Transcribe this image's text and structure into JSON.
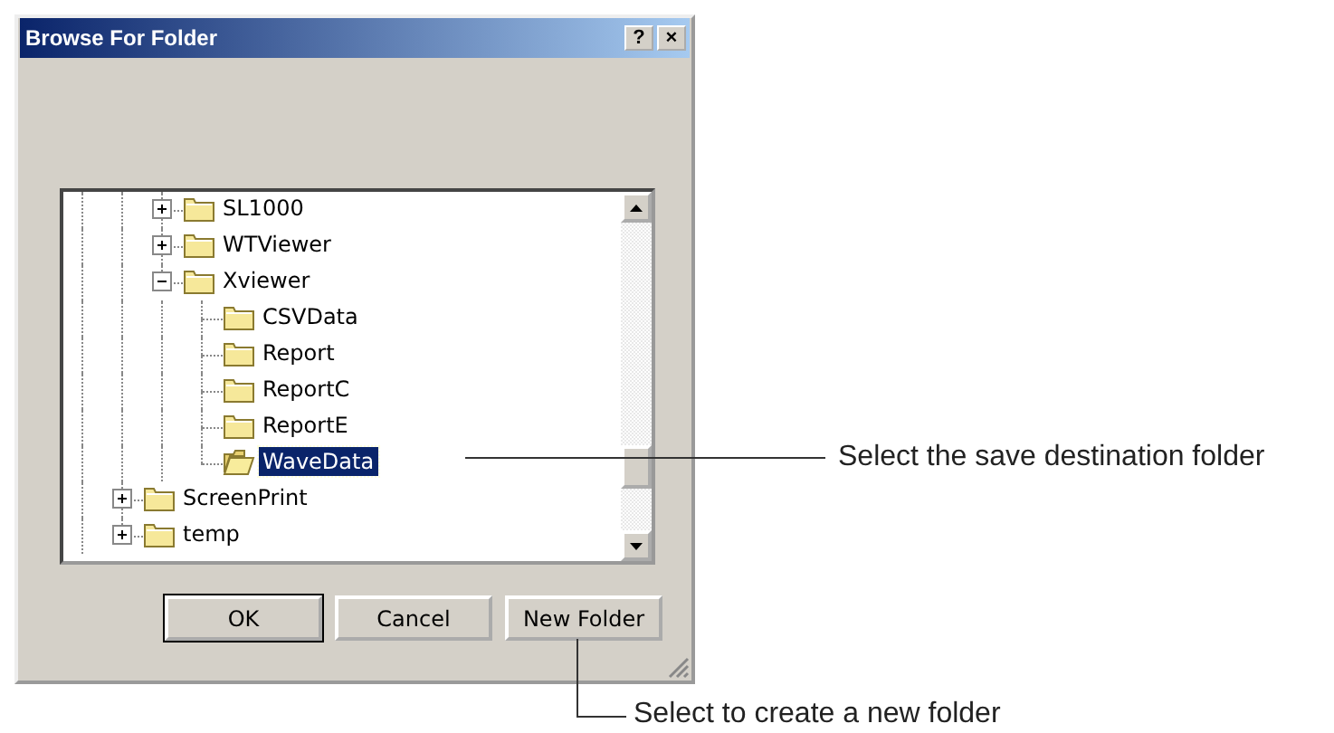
{
  "window": {
    "title": "Browse For Folder",
    "title_buttons": [
      "?",
      "×"
    ]
  },
  "tree": {
    "items": [
      {
        "children": [
          {
            "label": "SL1000",
            "expanded": false,
            "selected": false
          },
          {
            "label": "WTViewer",
            "expanded": false,
            "selected": false
          },
          {
            "label": "Xviewer",
            "expanded": true,
            "selected": false,
            "children": [
              {
                "label": "CSVData",
                "selected": false
              },
              {
                "label": "Report",
                "selected": false
              },
              {
                "label": "ReportC",
                "selected": false
              },
              {
                "label": "ReportE",
                "selected": false
              },
              {
                "label": "WaveData",
                "selected": true
              }
            ]
          }
        ]
      },
      {
        "label": "ScreenPrint",
        "expanded": false,
        "selected": false
      },
      {
        "label": "temp",
        "expanded": false,
        "selected": false
      }
    ]
  },
  "buttons": [
    {
      "label": "OK",
      "kind": "default"
    },
    {
      "label": "Cancel",
      "kind": "normal"
    },
    {
      "label": "New Folder",
      "kind": "normal"
    }
  ],
  "annotations": [
    {
      "text": "Select the save destination folder"
    },
    {
      "text": "Select to create a new folder"
    }
  ]
}
